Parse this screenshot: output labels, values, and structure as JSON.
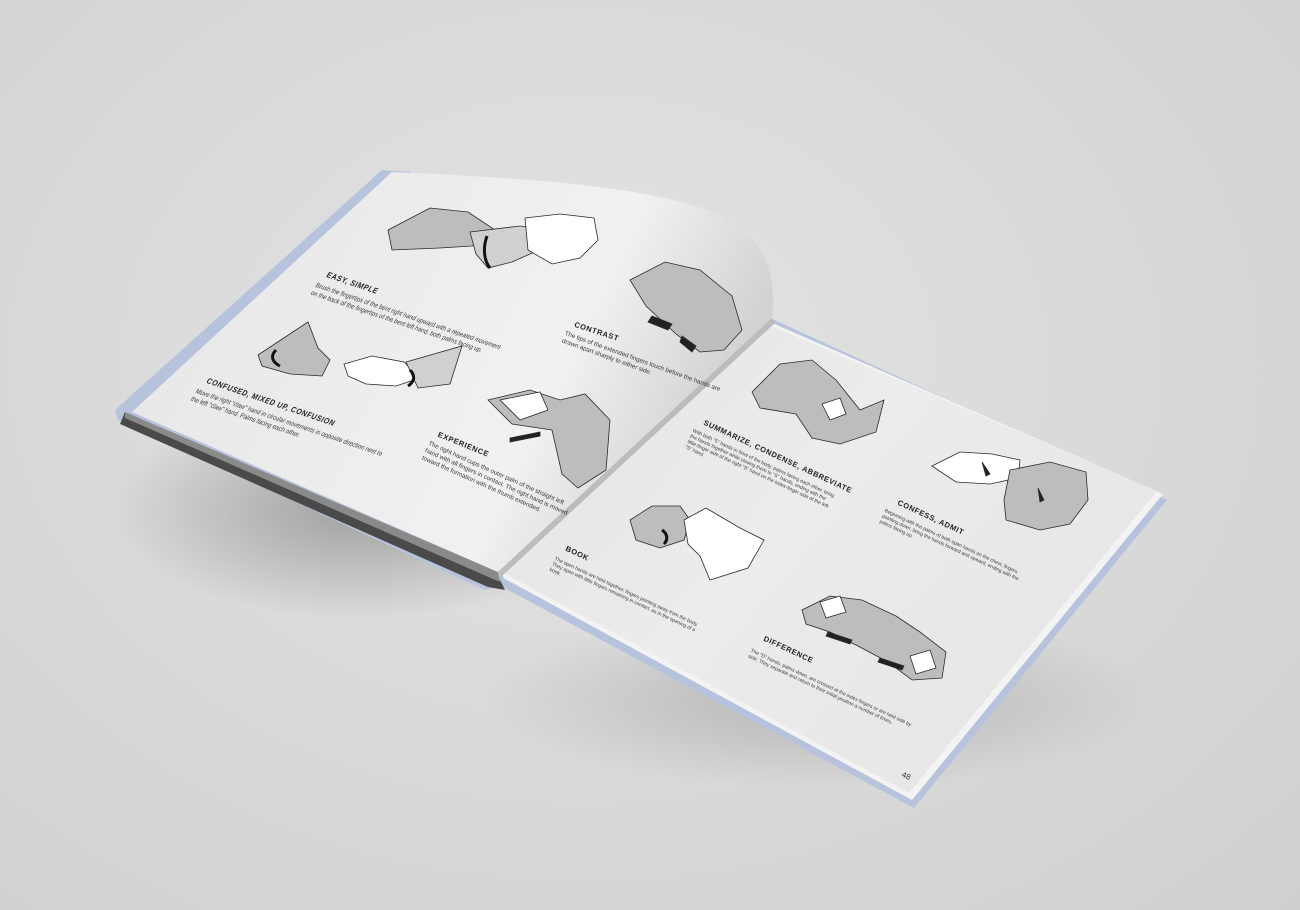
{
  "left_page": {
    "entries": [
      {
        "title": "EASY, SIMPLE",
        "text": "Brush the fingertips of the bent right hand upward with a repeated movement on the back of the fingertips of the bent left hand, both palms facing up."
      },
      {
        "title": "CONFUSED, MIXED UP, CONFUSION",
        "text": "Move the right \"claw\" hand in circular movements in opposite direction next to the left \"claw\" hand. Palms facing each other."
      },
      {
        "title": "CONTRAST",
        "text": "The tips of the extended fingers touch before the hands are drawn apart sharply to either side."
      },
      {
        "title": "EXPERIENCE",
        "text": "The right hand cups the outer palm of the straight left hand with all fingers in contact. The right hand is moved toward the formation with the thumb extended."
      }
    ]
  },
  "right_page": {
    "entries": [
      {
        "title": "SUMMARIZE, CONDENSE, ABBREVIATE",
        "text": "With both \"5\" hands in front of the body, palms facing each other, bring the hands together while closing them to \"S\" hands, ending with the little-finger side of the right \"S\" hand on the index-finger side of the left \"S\" hand."
      },
      {
        "title": "CONFESS, ADMIT",
        "text": "Beginning with the palms of both open hands on the chest, fingers pointing down, bring the hands forward and upward, ending with the palms facing up."
      },
      {
        "title": "BOOK",
        "text": "The open hands are held together, fingers pointing away from the body. They open with little fingers remaining in contact, as in the opening of a book."
      },
      {
        "title": "DIFFERENCE",
        "text": "The \"D\" hands, palms down, are crossed at the index fingers or are held side by side. They separate and return to their initial position a number of times."
      }
    ],
    "page_number": "48"
  },
  "colors": {
    "background": "#dcdcdc",
    "cover": "#b7c3dd",
    "page": "#ececec",
    "illustration_fill": "#bdbdbd",
    "ink": "#1f1f1f"
  }
}
